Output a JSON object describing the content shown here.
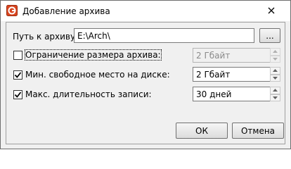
{
  "window": {
    "title": "Добавление архива",
    "close_label": "×"
  },
  "form": {
    "path_label": "Путь к архиву:",
    "path_value": "E:\\Arch\\",
    "browse_label": "...",
    "limit_size_label": "Ограничение размера архива:",
    "limit_size_checked": false,
    "limit_size_value": "2 Гбайт",
    "min_free_label": "Мин. свободное место на диске:",
    "min_free_checked": true,
    "min_free_value": "2 Гбайт",
    "max_duration_label": "Макс. длительность записи:",
    "max_duration_checked": true,
    "max_duration_value": "30 дней"
  },
  "buttons": {
    "ok_label": "ОК",
    "cancel_label": "Отмена"
  },
  "colors": {
    "icon_red": "#d9451f",
    "check": "#000000"
  }
}
